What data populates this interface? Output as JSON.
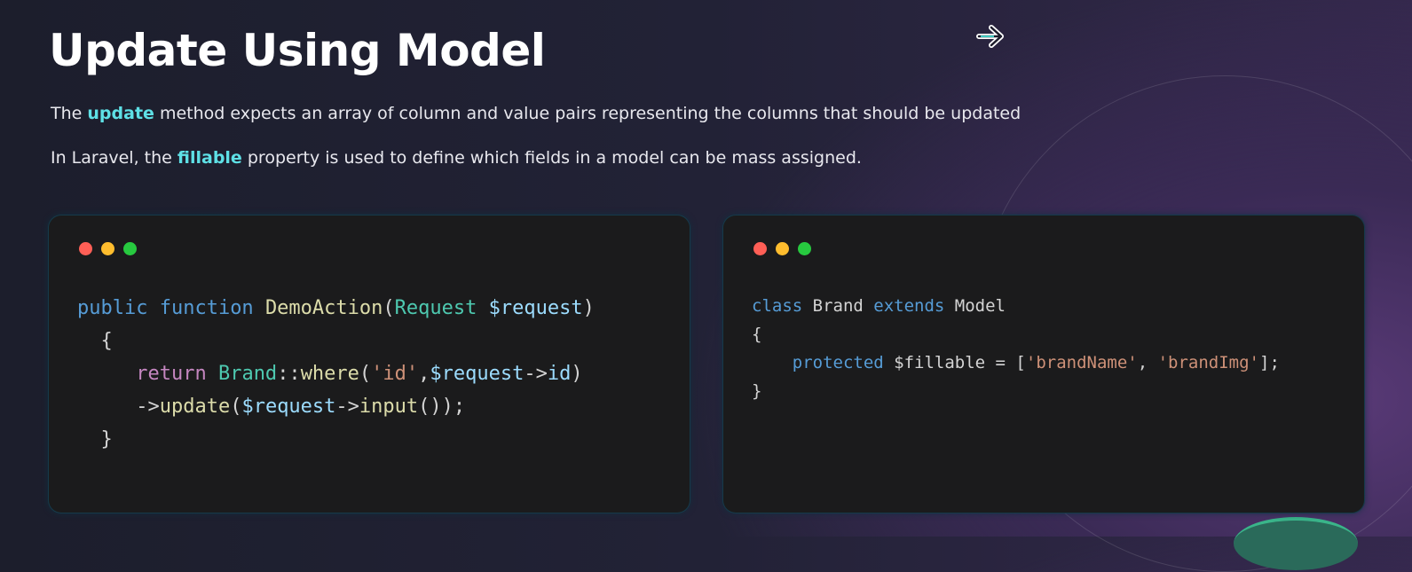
{
  "title": "Update Using Model",
  "para1": {
    "pre": "The ",
    "hl": "update",
    "post": " method expects an array of column and value pairs representing the columns that should be updated"
  },
  "para2": {
    "pre": "In Laravel, the ",
    "hl": "fillable",
    "post": " property is used to define which fields in a model can be mass assigned."
  },
  "icons": {
    "next": "arrow-right-icon"
  },
  "colors": {
    "accent": "#5ee0e6",
    "dot_red": "#ff5f56",
    "dot_yellow": "#ffbd2e",
    "dot_green": "#27c93f"
  },
  "code_left": [
    [
      [
        "public ",
        "#569cd6"
      ],
      [
        "function ",
        "#569cd6"
      ],
      [
        "DemoAction",
        "#dcdcaa"
      ],
      [
        "(",
        "#d4d4d4"
      ],
      [
        "Request ",
        "#4ec9b0"
      ],
      [
        "$request",
        "#9cdcfe"
      ],
      [
        ")",
        "#d4d4d4"
      ]
    ],
    [
      [
        "  {",
        "#d4d4d4"
      ]
    ],
    [
      [
        "     return ",
        "#c586c0"
      ],
      [
        "Brand",
        "#4ec9b0"
      ],
      [
        "::",
        "#d4d4d4"
      ],
      [
        "where",
        "#dcdcaa"
      ],
      [
        "(",
        "#d4d4d4"
      ],
      [
        "'id'",
        "#ce9178"
      ],
      [
        ",",
        "#d4d4d4"
      ],
      [
        "$request",
        "#9cdcfe"
      ],
      [
        "->",
        "#d4d4d4"
      ],
      [
        "id",
        "#9cdcfe"
      ],
      [
        ")",
        "#d4d4d4"
      ]
    ],
    [
      [
        "     ->",
        "#d4d4d4"
      ],
      [
        "update",
        "#dcdcaa"
      ],
      [
        "(",
        "#d4d4d4"
      ],
      [
        "$request",
        "#9cdcfe"
      ],
      [
        "->",
        "#d4d4d4"
      ],
      [
        "input",
        "#dcdcaa"
      ],
      [
        "());",
        "#d4d4d4"
      ]
    ],
    [
      [
        "  }",
        "#d4d4d4"
      ]
    ]
  ],
  "code_right": [
    [
      [
        "class ",
        "#569cd6"
      ],
      [
        "Brand ",
        "#d4d4d4"
      ],
      [
        "extends ",
        "#569cd6"
      ],
      [
        "Model",
        "#d4d4d4"
      ]
    ],
    [
      [
        "{",
        "#d4d4d4"
      ]
    ],
    [
      [
        "    protected ",
        "#569cd6"
      ],
      [
        "$fillable = [",
        "#d4d4d4"
      ],
      [
        "'brandName'",
        "#ce9178"
      ],
      [
        ", ",
        "#d4d4d4"
      ],
      [
        "'brandImg'",
        "#ce9178"
      ],
      [
        "];",
        "#d4d4d4"
      ]
    ],
    [
      [
        "}",
        "#d4d4d4"
      ]
    ]
  ]
}
